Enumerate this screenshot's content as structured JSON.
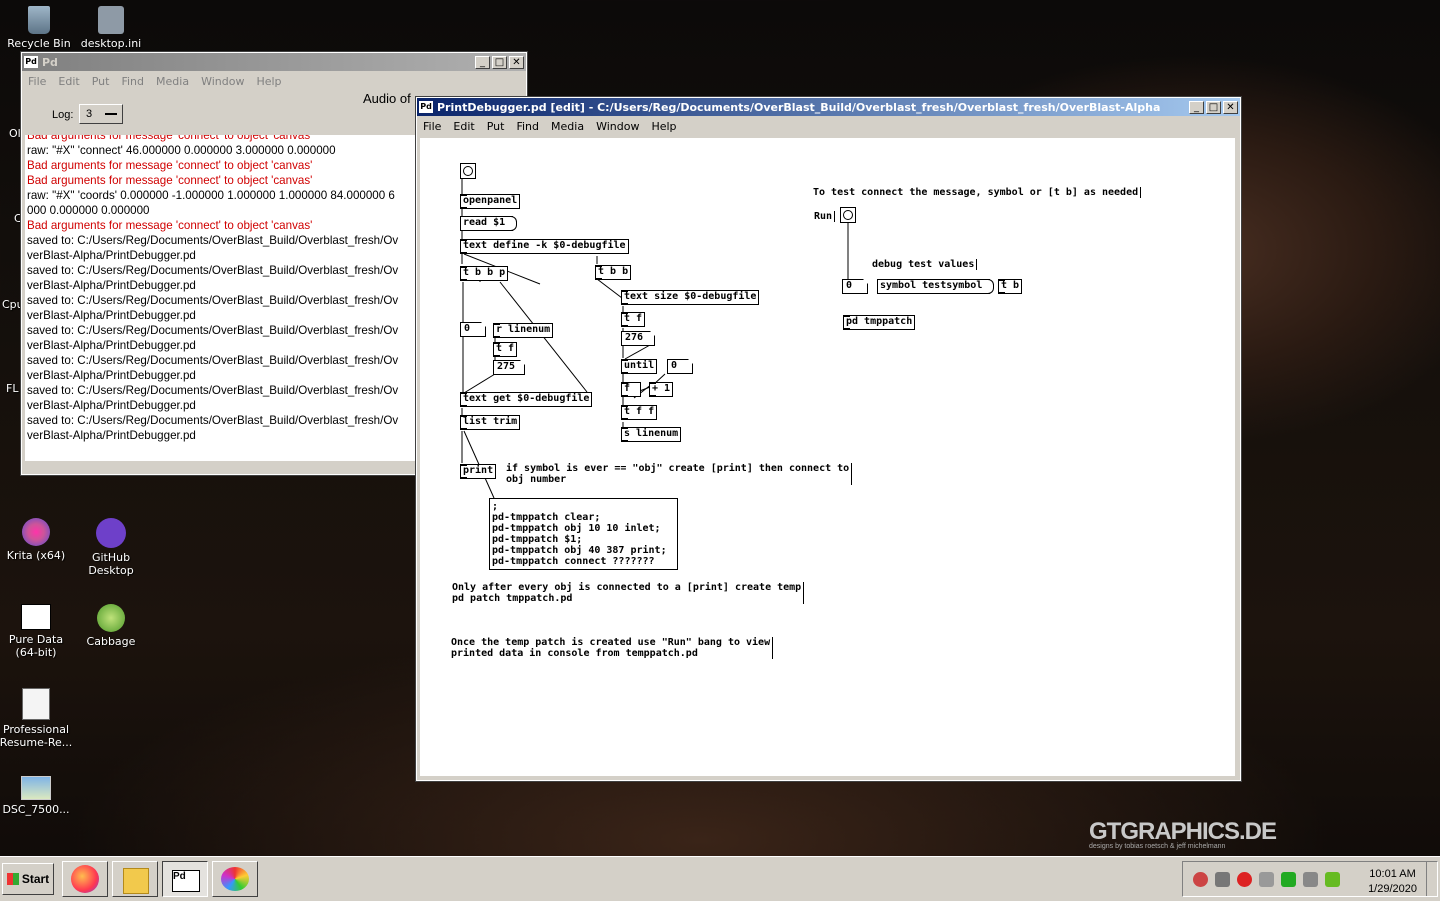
{
  "desktop": {
    "icons": [
      {
        "label": "Recycle Bin"
      },
      {
        "label": "desktop.ini"
      },
      {
        "label": "Krita (x64)"
      },
      {
        "label": "GitHub\nDesktop"
      },
      {
        "label": "Pure Data\n(64-bit)"
      },
      {
        "label": "Cabbage"
      },
      {
        "label": "Professional\nResume-Re..."
      },
      {
        "label": "DSC_7500..."
      }
    ],
    "partial_labels": [
      "Ol",
      "C",
      "Cpu",
      "FL",
      "...",
      "..."
    ]
  },
  "pd_window": {
    "title": "Pd",
    "menu": [
      "File",
      "Edit",
      "Put",
      "Find",
      "Media",
      "Window",
      "Help"
    ],
    "log_label": "Log:",
    "log_value": "3",
    "audio_text": "Audio of",
    "console": [
      {
        "text": "Bad arguments for message 'connect' to object 'canvas'",
        "error": true
      },
      {
        "text": "raw: \"#X\" 'connect' 46.000000 0.000000 3.000000 0.000000",
        "error": false
      },
      {
        "text": "Bad arguments for message 'connect' to object 'canvas'",
        "error": true
      },
      {
        "text": "Bad arguments for message 'connect' to object 'canvas'",
        "error": true
      },
      {
        "text": "raw: \"#X\" 'coords' 0.000000 -1.000000 1.000000 1.000000 84.000000 6",
        "error": false
      },
      {
        "text": "000 0.000000 0.000000",
        "error": false
      },
      {
        "text": "Bad arguments for message 'connect' to object 'canvas'",
        "error": true
      },
      {
        "text": "saved to: C:/Users/Reg/Documents/OverBlast_Build/Overblast_fresh/Ov",
        "error": false
      },
      {
        "text": "verBlast-Alpha/PrintDebugger.pd",
        "error": false
      },
      {
        "text": "saved to: C:/Users/Reg/Documents/OverBlast_Build/Overblast_fresh/Ov",
        "error": false
      },
      {
        "text": "verBlast-Alpha/PrintDebugger.pd",
        "error": false
      },
      {
        "text": "saved to: C:/Users/Reg/Documents/OverBlast_Build/Overblast_fresh/Ov",
        "error": false
      },
      {
        "text": "verBlast-Alpha/PrintDebugger.pd",
        "error": false
      },
      {
        "text": "saved to: C:/Users/Reg/Documents/OverBlast_Build/Overblast_fresh/Ov",
        "error": false
      },
      {
        "text": "verBlast-Alpha/PrintDebugger.pd",
        "error": false
      },
      {
        "text": "saved to: C:/Users/Reg/Documents/OverBlast_Build/Overblast_fresh/Ov",
        "error": false
      },
      {
        "text": "verBlast-Alpha/PrintDebugger.pd",
        "error": false
      },
      {
        "text": "saved to: C:/Users/Reg/Documents/OverBlast_Build/Overblast_fresh/Ov",
        "error": false
      },
      {
        "text": "verBlast-Alpha/PrintDebugger.pd",
        "error": false
      },
      {
        "text": "saved to: C:/Users/Reg/Documents/OverBlast_Build/Overblast_fresh/Ov",
        "error": false
      },
      {
        "text": "verBlast-Alpha/PrintDebugger.pd",
        "error": false
      }
    ]
  },
  "patch_window": {
    "title": "PrintDebugger.pd  [edit] - C:/Users/Reg/Documents/OverBlast_Build/Overblast_fresh/Overblast_fresh/OverBlast-Alpha",
    "menu": [
      "File",
      "Edit",
      "Put",
      "Find",
      "Media",
      "Window",
      "Help"
    ],
    "objects": {
      "openpanel": "openpanel",
      "read": "read $1",
      "text_define": "text define -k $0-debugfile",
      "tbbp": "t b b p",
      "tbb": "t b b",
      "text_size": "text size $0-debugfile",
      "num0a": "0",
      "r_linenum": "r linenum",
      "tf1": "t f",
      "num275": "275",
      "tf2": "t f",
      "num276": "276",
      "until": "until",
      "num0b": "0",
      "f": "f",
      "plus1": "+ 1",
      "tff": "t f f",
      "s_linenum": "s linenum",
      "text_get": "text get $0-debugfile",
      "list_trim": "list trim",
      "print": "print",
      "run_label": "Run",
      "num0c": "0",
      "symbol_test": "symbol testsymbol",
      "tb": "t b",
      "pd_tmppatch": "pd tmppatch"
    },
    "comments": {
      "test_connect": "To test connect the message, symbol or [t b] as needed",
      "debug_values": "debug test values",
      "if_symbol": "if symbol is ever == \"obj\" create [print] then connect to\nobj number",
      "only_after": "Only after every obj is connected to a [print] create temp\npd patch tmppatch.pd",
      "once_temp": "Once the temp patch is created use \"Run\" bang to view\nprinted data in console from temppatch.pd"
    },
    "tmppatch_msg": ";\npd-tmppatch clear;\npd-tmppatch obj 10 10 inlet;\npd-tmppatch $1;\npd-tmppatch obj 40 387 print;\npd-tmppatch connect ???????"
  },
  "taskbar": {
    "start_label": "Start",
    "time": "10:01 AM",
    "date": "1/29/2020"
  },
  "watermark": {
    "brand": "GTGRAPHICS.DE",
    "credit": "designs by tobias roetsch & jeff michelmann"
  }
}
